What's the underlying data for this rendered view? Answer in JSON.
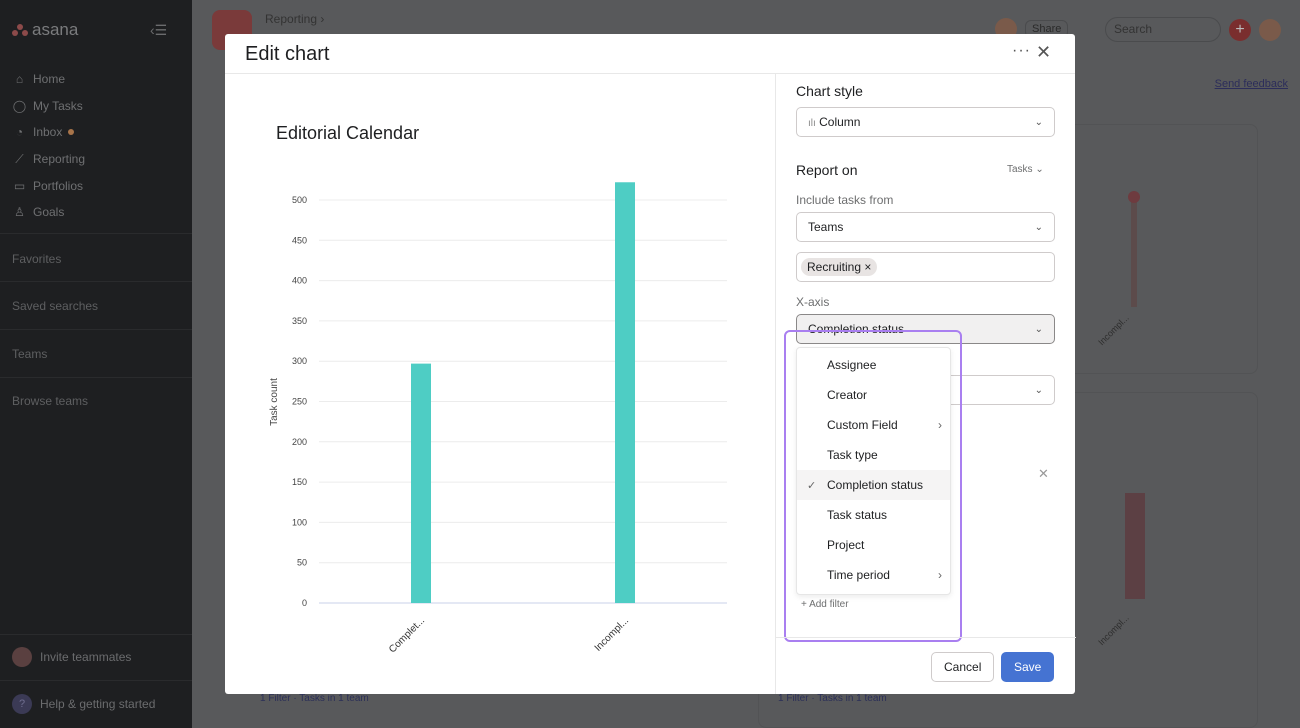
{
  "sidebar": {
    "logo": "asana",
    "items": [
      {
        "label": "Home",
        "icon": "home-icon"
      },
      {
        "label": "My Tasks",
        "icon": "check-circle-icon"
      },
      {
        "label": "Inbox",
        "icon": "bell-icon"
      },
      {
        "label": "Reporting",
        "icon": "trend-icon"
      },
      {
        "label": "Portfolios",
        "icon": "folder-icon"
      },
      {
        "label": "Goals",
        "icon": "person-icon"
      }
    ],
    "sections": [
      "Favorites",
      "Saved searches",
      "Teams",
      "Browse teams"
    ],
    "invite": "Invite teammates",
    "help": "Help & getting started"
  },
  "background": {
    "breadcrumb": "Reporting ›",
    "share": "Share",
    "search_placeholder": "Search",
    "send_feedback": "Send feedback",
    "filter_summary": "1 Filter · Tasks in 1 team",
    "card_labels": [
      "Incompl...",
      "Incompl..."
    ]
  },
  "modal": {
    "title": "Edit chart",
    "more": "···",
    "close": "✕",
    "cancel": "Cancel",
    "save": "Save"
  },
  "settings": {
    "chart_style_label": "Chart style",
    "chart_style": "Column",
    "report_on_label": "Report on",
    "report_on": "Tasks",
    "include_label": "Include tasks from",
    "include": "Teams",
    "team_chip": "Recruiting",
    "xaxis_label": "X-axis",
    "xaxis": "Completion status",
    "menu": [
      {
        "label": "Assignee"
      },
      {
        "label": "Creator"
      },
      {
        "label": "Custom Field",
        "submenu": true
      },
      {
        "label": "Task type"
      },
      {
        "label": "Completion status",
        "selected": true
      },
      {
        "label": "Task status"
      },
      {
        "label": "Project"
      },
      {
        "label": "Time period",
        "submenu": true
      }
    ],
    "add_filter": "Add filter"
  },
  "chart_data": {
    "type": "bar",
    "title": "Editorial Calendar",
    "ylabel": "Task count",
    "xlabel": "",
    "categories": [
      "Complet...",
      "Incompl..."
    ],
    "values": [
      297,
      522
    ],
    "ylim": [
      0,
      500
    ],
    "yticks": [
      0,
      50,
      100,
      150,
      200,
      250,
      300,
      350,
      400,
      450,
      500
    ],
    "grid": true,
    "bar_color": "#4ecdc4"
  }
}
